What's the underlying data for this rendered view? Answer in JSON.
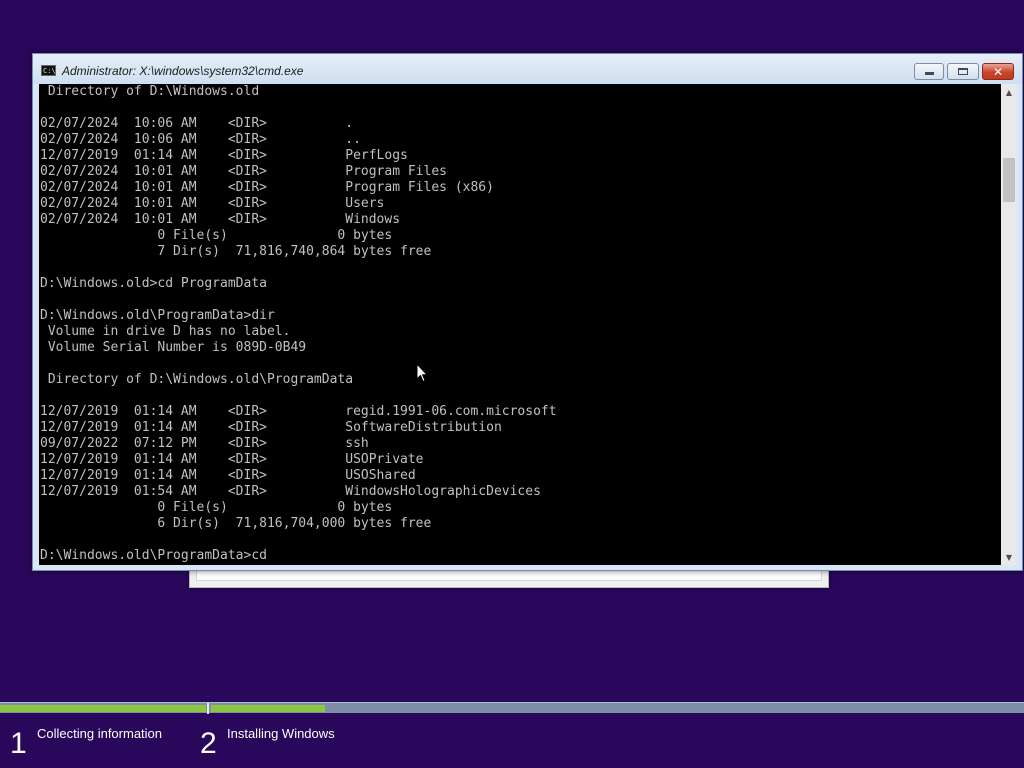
{
  "window": {
    "title": "Administrator: X:\\windows\\system32\\cmd.exe",
    "icon": "cmd-console-icon",
    "buttons": {
      "minimize": "minimize-icon",
      "maximize": "maximize-icon",
      "close": "✕"
    }
  },
  "console": {
    "lines": [
      " Directory of D:\\Windows.old",
      "",
      "02/07/2024  10:06 AM    <DIR>          .",
      "02/07/2024  10:06 AM    <DIR>          ..",
      "12/07/2019  01:14 AM    <DIR>          PerfLogs",
      "02/07/2024  10:01 AM    <DIR>          Program Files",
      "02/07/2024  10:01 AM    <DIR>          Program Files (x86)",
      "02/07/2024  10:01 AM    <DIR>          Users",
      "02/07/2024  10:01 AM    <DIR>          Windows",
      "               0 File(s)              0 bytes",
      "               7 Dir(s)  71,816,740,864 bytes free",
      "",
      "D:\\Windows.old>cd ProgramData",
      "",
      "D:\\Windows.old\\ProgramData>dir",
      " Volume in drive D has no label.",
      " Volume Serial Number is 089D-0B49",
      "",
      " Directory of D:\\Windows.old\\ProgramData",
      "",
      "12/07/2019  01:14 AM    <DIR>          regid.1991-06.com.microsoft",
      "12/07/2019  01:14 AM    <DIR>          SoftwareDistribution",
      "09/07/2022  07:12 PM    <DIR>          ssh",
      "12/07/2019  01:14 AM    <DIR>          USOPrivate",
      "12/07/2019  01:14 AM    <DIR>          USOShared",
      "12/07/2019  01:54 AM    <DIR>          WindowsHolographicDevices",
      "               0 File(s)              0 bytes",
      "               6 Dir(s)  71,816,704,000 bytes free",
      "",
      "D:\\Windows.old\\ProgramData>cd"
    ]
  },
  "scrollbar": {
    "up_arrow": "▲",
    "down_arrow": "▼"
  },
  "setup": {
    "steps": [
      {
        "number": "1",
        "label": "Collecting information"
      },
      {
        "number": "2",
        "label": "Installing Windows"
      }
    ],
    "progress": {
      "step1_fraction": 1.0,
      "step2_fraction": 0.14
    }
  },
  "colors": {
    "desktop_bg": "#29075a",
    "console_bg": "#000000",
    "console_fg": "#c0c0c0",
    "progress_fill": "#8cc63f",
    "progress_track": "#7f8ea8"
  }
}
